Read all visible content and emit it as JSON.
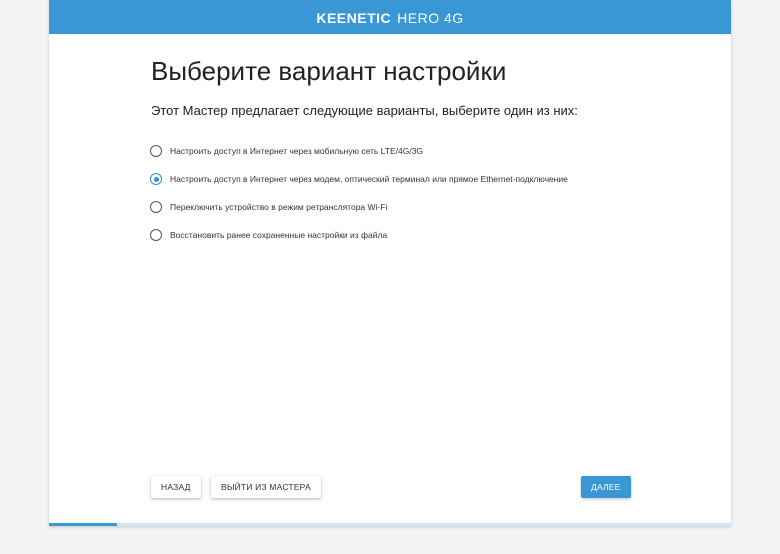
{
  "header": {
    "brand_name": "KEENETIC",
    "brand_model": "HERO 4G",
    "bar_color": "#3a97d6"
  },
  "page": {
    "title": "Выберите вариант настройки",
    "subtitle": "Этот Мастер предлагает следующие варианты, выберите один из них:"
  },
  "options": [
    {
      "label": "Настроить доступ в Интернет через мобильную сеть LTE/4G/3G",
      "checked": false
    },
    {
      "label": "Настроить доступ в Интернет через модем, оптический терминал или прямое Ethernet-подключение",
      "checked": true
    },
    {
      "label": "Переключить устройство в режим ретранслятора Wi-Fi",
      "checked": false
    },
    {
      "label": "Восстановить ранее сохраненные настройки из файла",
      "checked": false
    }
  ],
  "buttons": {
    "back": "НАЗАД",
    "exit": "ВЫЙТИ ИЗ МАСТЕРА",
    "next": "ДАЛЕЕ"
  },
  "progress": {
    "fraction": 0.1
  }
}
